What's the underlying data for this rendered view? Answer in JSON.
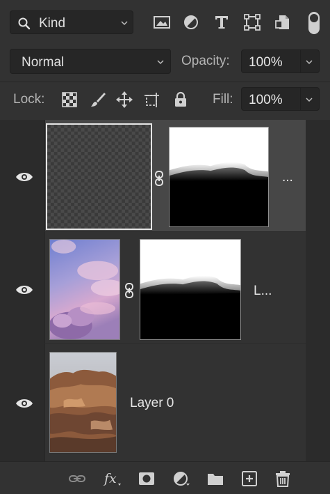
{
  "filter": {
    "kind_label": "Kind",
    "icons": [
      "image-filter-icon",
      "adjustment-filter-icon",
      "type-filter-icon",
      "shape-filter-icon",
      "smart-object-filter-icon",
      "filter-toggle-icon"
    ]
  },
  "blend": {
    "mode": "Normal",
    "opacity_label": "Opacity:",
    "opacity_value": "100%"
  },
  "lock": {
    "label": "Lock:",
    "icons": [
      "lock-transparent-pixels-icon",
      "lock-image-pixels-icon",
      "lock-position-icon",
      "lock-artboard-icon",
      "lock-all-icon"
    ],
    "fill_label": "Fill:",
    "fill_value": "100%"
  },
  "layers": [
    {
      "name": "...",
      "selected": true,
      "visible": true,
      "thumb": "transparent-checkerboard",
      "mask": "mountain-silhouette-mask"
    },
    {
      "name": "L...",
      "selected": false,
      "visible": true,
      "thumb": "pink-sky-clouds",
      "mask": "mountain-silhouette-mask"
    },
    {
      "name": "Layer 0",
      "selected": false,
      "visible": true,
      "thumb": "rocky-desert-hills"
    }
  ],
  "bottom_bar": {
    "icons": [
      "link-layers-icon",
      "fx-icon",
      "add-mask-icon",
      "adjustment-layer-icon",
      "new-group-icon",
      "new-layer-icon",
      "delete-layer-icon"
    ]
  },
  "colors": {
    "panel": "#323232",
    "selected_row": "#474747",
    "text": "#e6e6e6",
    "muted": "#b5b5b5"
  }
}
